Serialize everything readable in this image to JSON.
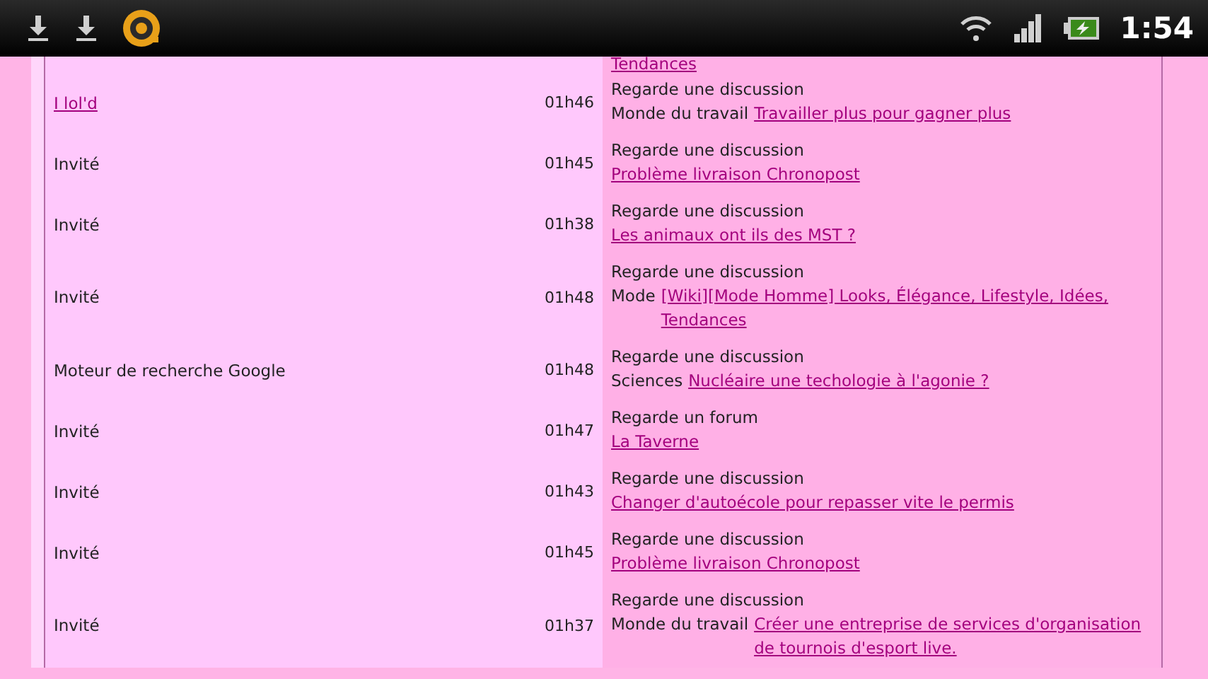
{
  "status_bar": {
    "time": "1:54"
  },
  "top_fragment": {
    "link": "Tendances"
  },
  "rows": [
    {
      "user": {
        "kind": "member",
        "name": "I lol'd"
      },
      "time": "01h46",
      "action": "Regarde une discussion",
      "category": "Monde du travail",
      "link": "Travailler plus pour gagner plus"
    },
    {
      "user": {
        "kind": "guest",
        "name": "Invité"
      },
      "time": "01h45",
      "action": "Regarde une discussion",
      "link": "Problème livraison Chronopost"
    },
    {
      "user": {
        "kind": "guest",
        "name": "Invité"
      },
      "time": "01h38",
      "action": "Regarde une discussion",
      "link": "Les animaux ont ils des MST ?"
    },
    {
      "user": {
        "kind": "guest",
        "name": "Invité"
      },
      "time": "01h48",
      "action": "Regarde une discussion",
      "category": "Mode",
      "link": "[Wiki][Mode Homme] Looks, Élégance, Lifestyle, Idées, Tendances"
    },
    {
      "user": {
        "kind": "guest",
        "name": "Moteur de recherche Google"
      },
      "time": "01h48",
      "action": "Regarde une discussion",
      "category": "Sciences",
      "link": "Nucléaire une techologie à l'agonie ?"
    },
    {
      "user": {
        "kind": "guest",
        "name": "Invité"
      },
      "time": "01h47",
      "action": "Regarde un forum",
      "link": "La Taverne"
    },
    {
      "user": {
        "kind": "guest",
        "name": "Invité"
      },
      "time": "01h43",
      "action": "Regarde une discussion",
      "link": "Changer d'autoécole pour repasser vite le permis"
    },
    {
      "user": {
        "kind": "guest",
        "name": "Invité"
      },
      "time": "01h45",
      "action": "Regarde une discussion",
      "link": "Problème livraison Chronopost"
    },
    {
      "user": {
        "kind": "guest",
        "name": "Invité"
      },
      "time": "01h37",
      "action": "Regarde une discussion",
      "category": "Monde du travail",
      "link": "Créer une entreprise de services d'organisation de tournois d'esport live."
    }
  ]
}
